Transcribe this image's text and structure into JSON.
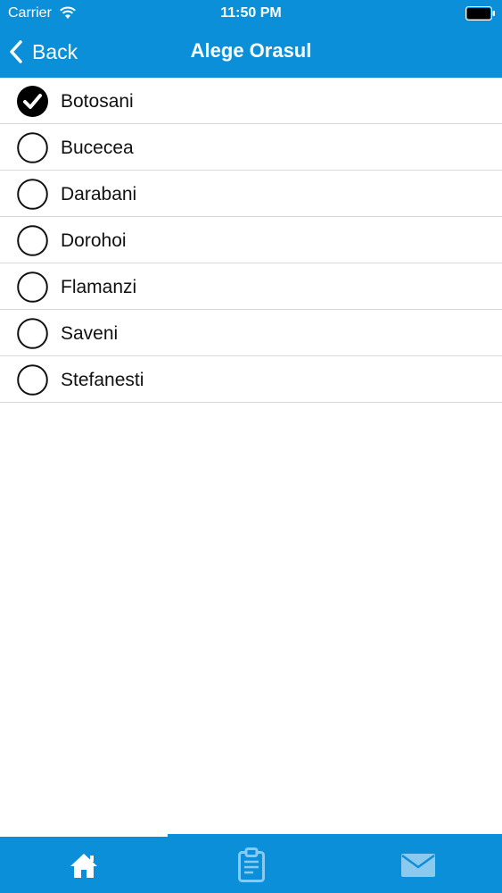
{
  "status_bar": {
    "carrier": "Carrier",
    "time": "11:50 PM"
  },
  "nav": {
    "back_label": "Back",
    "title": "Alege Orasul"
  },
  "cities": [
    {
      "name": "Botosani",
      "selected": true
    },
    {
      "name": "Bucecea",
      "selected": false
    },
    {
      "name": "Darabani",
      "selected": false
    },
    {
      "name": "Dorohoi",
      "selected": false
    },
    {
      "name": "Flamanzi",
      "selected": false
    },
    {
      "name": "Saveni",
      "selected": false
    },
    {
      "name": "Stefanesti",
      "selected": false
    }
  ],
  "tab_bar": {
    "tabs": [
      {
        "icon": "home-icon",
        "active": true
      },
      {
        "icon": "clipboard-icon",
        "active": false
      },
      {
        "icon": "envelope-icon",
        "active": false
      }
    ]
  },
  "colors": {
    "accent": "#0b8fd8",
    "tab_active": "#ffffff",
    "tab_inactive": "#8cc9ee",
    "separator": "#d8d8dc"
  }
}
